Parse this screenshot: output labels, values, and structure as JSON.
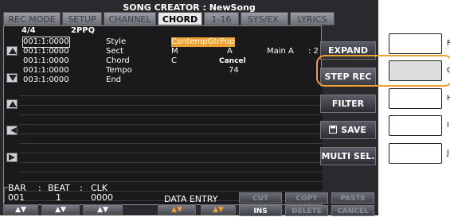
{
  "title": "SONG CREATOR : NewSong",
  "tabs": [
    "REC MODE",
    "SETUP",
    "CHANNEL",
    "CHORD",
    "1-16",
    "SYS/EX.",
    "LYRICS"
  ],
  "active_tab": "CHORD",
  "header": {
    "time_sig": "4/4",
    "resolution": "2PPQ"
  },
  "events": [
    {
      "time": "001:1:0000",
      "type": "Style",
      "d1": "ContempGtrPop",
      "d2": "",
      "d3": "",
      "d4": ""
    },
    {
      "time": "001:1:0000",
      "type": "Sect",
      "d1": "M",
      "d2": "A",
      "d3": "Main A",
      "d4": ": 2"
    },
    {
      "time": "001:1:0000",
      "type": "Chord",
      "d1": "C",
      "d2": "Cancel",
      "d3": "",
      "d4": ""
    },
    {
      "time": "001:1:0000",
      "type": "Tempo",
      "d1": "",
      "d2": "74",
      "d3": "",
      "d4": ""
    },
    {
      "time": "003:1:0000",
      "type": "End",
      "d1": "",
      "d2": "",
      "d3": "",
      "d4": ""
    }
  ],
  "right_buttons": {
    "expand": "EXPAND",
    "step_rec": "STEP REC",
    "filter": "FILTER",
    "save": "SAVE",
    "multi_sel": "MULTI SEL."
  },
  "bottom": {
    "bar_label": "BAR",
    "beat_label": "BEAT",
    "clk_label": "CLK",
    "bar_value": "001",
    "beat_value": "1",
    "clk_value": "0000",
    "data_entry": "DATA ENTRY",
    "cut": "CUT",
    "copy": "COPY",
    "paste": "PASTE",
    "ins": "INS",
    "delete": "DELETE",
    "cancel": "CANCEL",
    "arrow_label": "▲▼"
  },
  "hw_labels": [
    "F",
    "G",
    "H",
    "I",
    "J"
  ],
  "colors": {
    "highlight": "#f0a030",
    "callout": "#f0a030"
  }
}
